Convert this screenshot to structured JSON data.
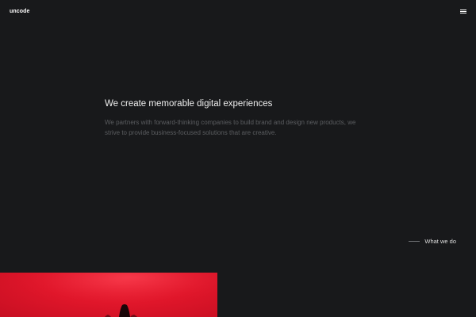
{
  "header": {
    "logo_text": "uncode",
    "menu_icon": "hamburger-menu-icon"
  },
  "hero": {
    "heading": "We create memorable digital experiences",
    "description": "We partners with forward-thinking companies to build brand and design new products, we strive to provide business-focused solutions that are creative."
  },
  "section_link": {
    "label": "What we do"
  },
  "colors": {
    "background": "#18191b",
    "accent_red": "#e0162a",
    "text_primary": "#eeeeee",
    "text_muted": "#5b5d60"
  }
}
